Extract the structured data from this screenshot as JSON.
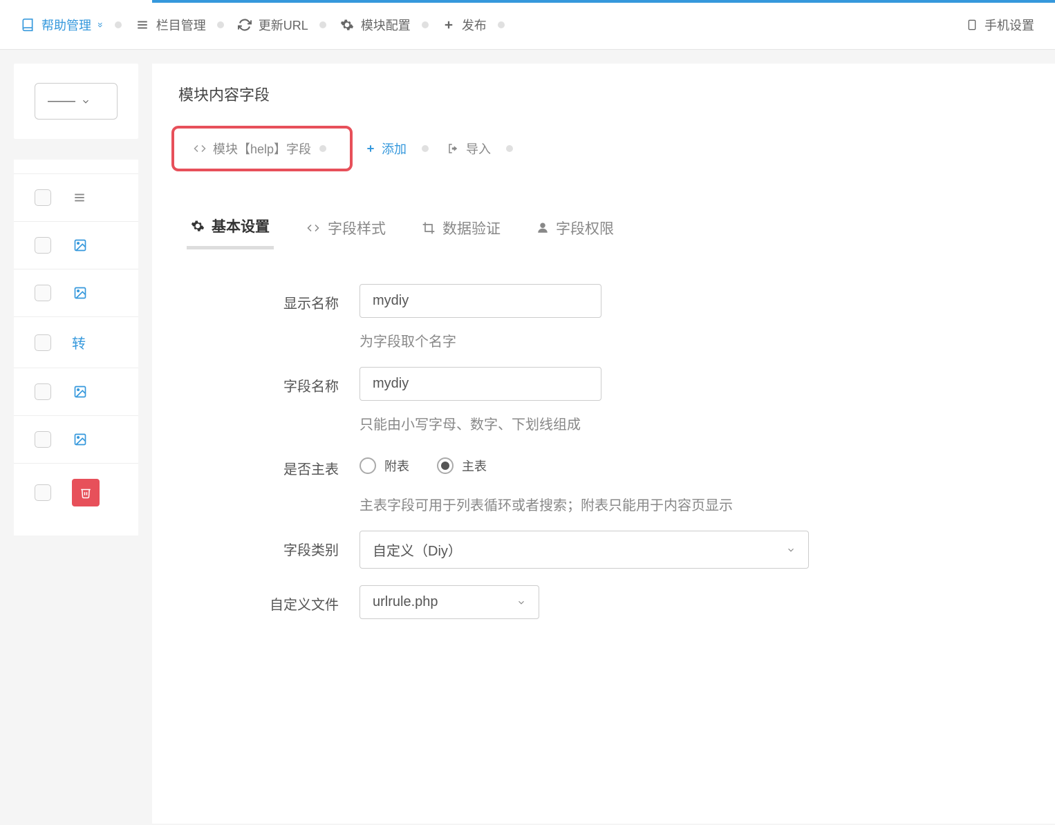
{
  "topbar": {
    "help_mgmt": "帮助管理",
    "column_mgmt": "栏目管理",
    "update_url": "更新URL",
    "module_config": "模块配置",
    "publish": "发布",
    "phone_settings": "手机设置"
  },
  "left": {
    "select_placeholder": "——"
  },
  "panel": {
    "title": "模块内容字段"
  },
  "submenu": {
    "module_field": "模块【help】字段",
    "add": "添加",
    "import": "导入"
  },
  "tabs": {
    "basic": "基本设置",
    "style": "字段样式",
    "validation": "数据验证",
    "permission": "字段权限"
  },
  "form": {
    "display_name": {
      "label": "显示名称",
      "value": "mydiy",
      "hint": "为字段取个名字"
    },
    "field_name": {
      "label": "字段名称",
      "value": "mydiy",
      "hint": "只能由小写字母、数字、下划线组成"
    },
    "main_table": {
      "label": "是否主表",
      "opt_sub": "附表",
      "opt_main": "主表",
      "hint": "主表字段可用于列表循环或者搜索；附表只能用于内容页显示"
    },
    "field_type": {
      "label": "字段类别",
      "value": "自定义（Diy）"
    },
    "custom_file": {
      "label": "自定义文件",
      "value": "urlrule.php"
    }
  }
}
